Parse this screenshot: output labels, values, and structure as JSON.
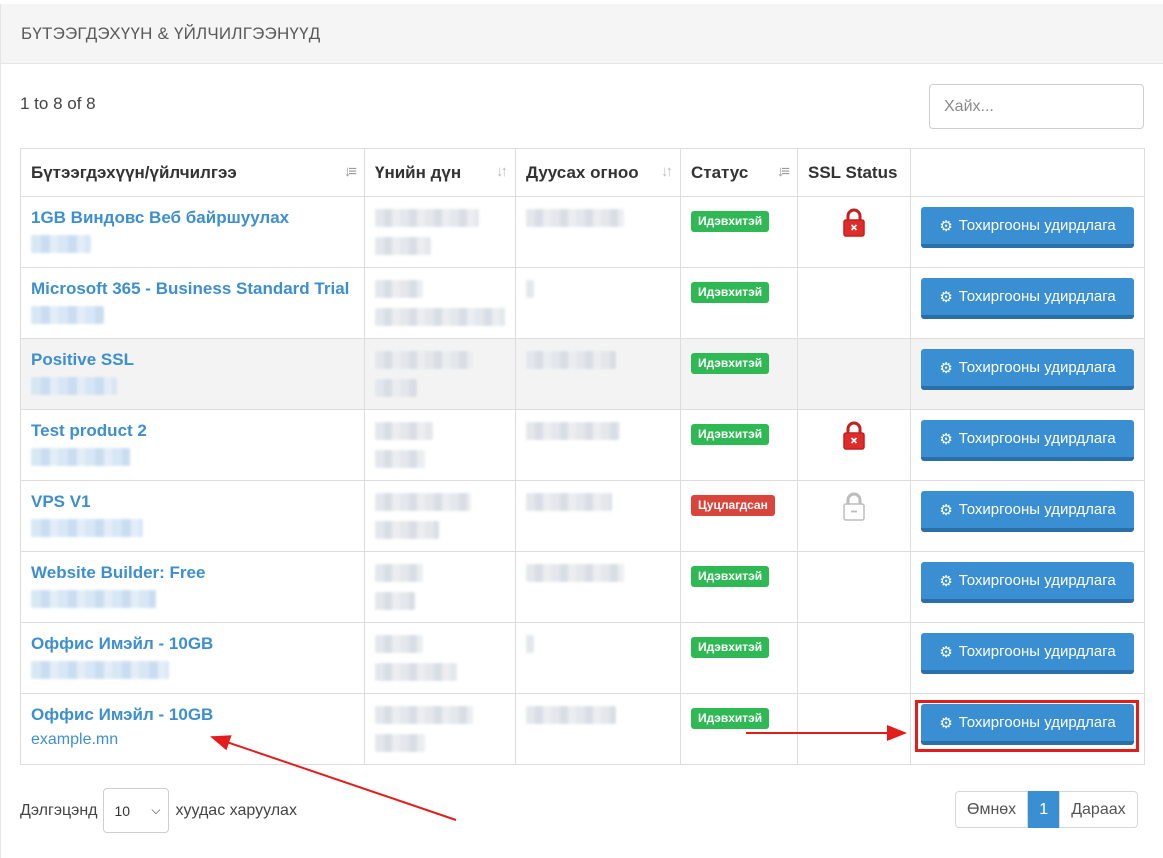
{
  "panel": {
    "title": "БҮТЭЭГДЭХҮҮН & ҮЙЛЧИЛГЭЭНҮҮД"
  },
  "table_info": "1 to 8 of 8",
  "search": {
    "placeholder": "Хайх..."
  },
  "columns": [
    {
      "label": "Бүтээгдэхүүн/үйлчилгээ",
      "sort_icon": "sort-amount-down-icon"
    },
    {
      "label": "Үнийн дүн",
      "sort_icon": "sort-icon"
    },
    {
      "label": "Дуусах огноо",
      "sort_icon": "sort-icon"
    },
    {
      "label": "Статус",
      "sort_icon": "sort-amount-down-icon"
    },
    {
      "label": "SSL Status"
    },
    {
      "label": ""
    }
  ],
  "rows": [
    {
      "name": "1GB Виндовс Веб байршуулах",
      "domain": "",
      "status": "Идэвхитэй",
      "status_type": "active",
      "ssl": "ssl-invalid-lock-icon",
      "action": "Тохиргооны удирдлага"
    },
    {
      "name": "Microsoft 365 - Business Standard Trial",
      "domain": "",
      "status": "Идэвхитэй",
      "status_type": "active",
      "ssl": "",
      "action": "Тохиргооны удирдлага"
    },
    {
      "name": "Positive SSL",
      "domain": "",
      "status": "Идэвхитэй",
      "status_type": "active",
      "ssl": "",
      "action": "Тохиргооны удирдлага"
    },
    {
      "name": "Test product 2",
      "domain": "",
      "status": "Идэвхитэй",
      "status_type": "active",
      "ssl": "ssl-invalid-lock-icon",
      "action": "Тохиргооны удирдлага"
    },
    {
      "name": "VPS V1",
      "domain": "",
      "status": "Цуцлагдсан",
      "status_type": "cancel",
      "ssl": "ssl-inactive-lock-icon",
      "action": "Тохиргооны удирдлага"
    },
    {
      "name": "Website Builder: Free",
      "domain": "",
      "status": "Идэвхитэй",
      "status_type": "active",
      "ssl": "",
      "action": "Тохиргооны удирдлага"
    },
    {
      "name": "Оффис Имэйл - 10GB",
      "domain": "",
      "status": "Идэвхитэй",
      "status_type": "active",
      "ssl": "",
      "action": "Тохиргооны удирдлага"
    },
    {
      "name": "Оффис Имэйл - 10GB",
      "domain": "example.mn",
      "status": "Идэвхитэй",
      "status_type": "active",
      "ssl": "",
      "action": "Тохиргооны удирдлага"
    }
  ],
  "footer": {
    "length_prefix": "Дэлгэцэнд",
    "length_value": "10",
    "length_suffix": "хуудас харуулах",
    "prev": "Өмнөх",
    "page": "1",
    "next": "Дараах"
  },
  "colors": {
    "accent": "#3a8fd3",
    "active": "#2fb955",
    "cancelled": "#d9443b",
    "annotation": "#e41c1c"
  }
}
